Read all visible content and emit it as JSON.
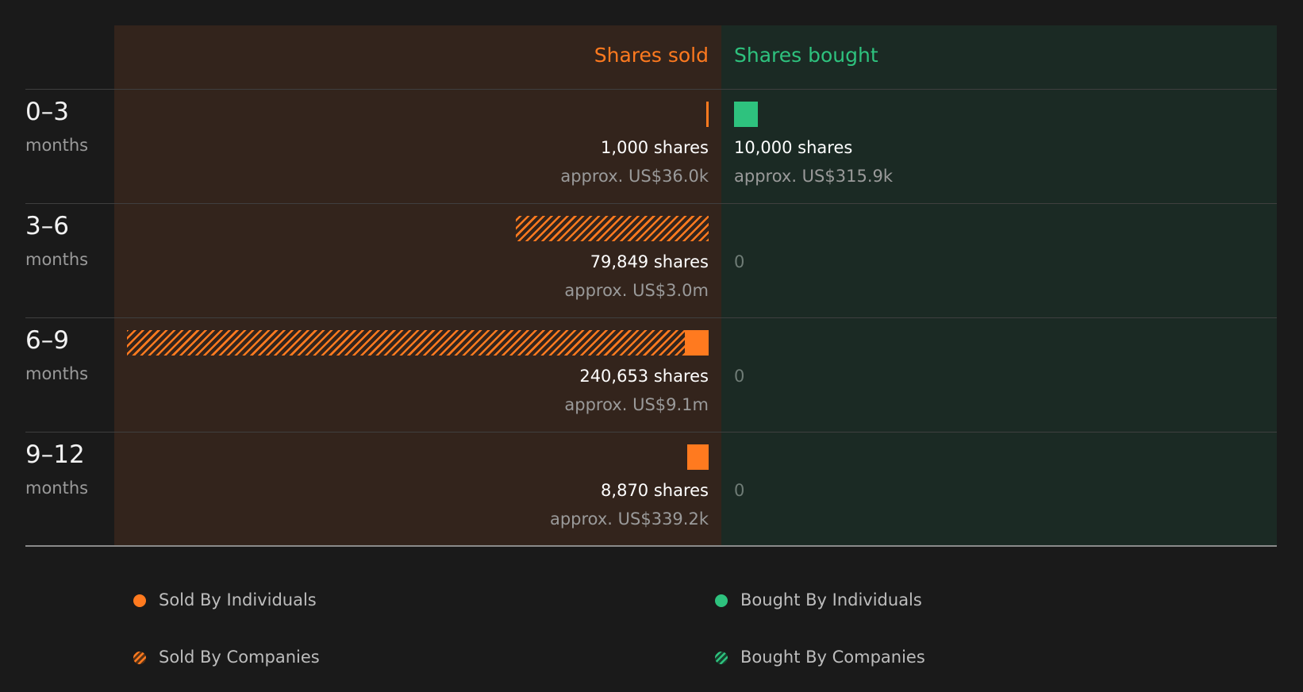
{
  "chart_data": {
    "type": "bar",
    "orientation": "horizontal-diverging",
    "columns": {
      "sold_label": "Shares sold",
      "bought_label": "Shares bought"
    },
    "categories": [
      "0–3",
      "3–6",
      "6–9",
      "9–12"
    ],
    "category_unit": "months",
    "rows": [
      {
        "period": "0–3",
        "unit": "months",
        "sold_individuals": 1000,
        "sold_companies": 0,
        "sold_shares_label": "1,000 shares",
        "sold_value_label": "approx. US$36.0k",
        "bought_individuals": 10000,
        "bought_companies": 0,
        "bought_shares_label": "10,000 shares",
        "bought_value_label": "approx. US$315.9k"
      },
      {
        "period": "3–6",
        "unit": "months",
        "sold_individuals": 0,
        "sold_companies": 79849,
        "sold_shares_label": "79,849 shares",
        "sold_value_label": "approx. US$3.0m",
        "bought_individuals": 0,
        "bought_companies": 0,
        "bought_shares_label": "0",
        "bought_value_label": ""
      },
      {
        "period": "6–9",
        "unit": "months",
        "sold_individuals": 10000,
        "sold_companies": 230653,
        "sold_shares_label": "240,653 shares",
        "sold_value_label": "approx. US$9.1m",
        "bought_individuals": 0,
        "bought_companies": 0,
        "bought_shares_label": "0",
        "bought_value_label": ""
      },
      {
        "period": "9–12",
        "unit": "months",
        "sold_individuals": 8870,
        "sold_companies": 0,
        "sold_shares_label": "8,870 shares",
        "sold_value_label": "approx. US$339.2k",
        "bought_individuals": 0,
        "bought_companies": 0,
        "bought_shares_label": "0",
        "bought_value_label": ""
      }
    ],
    "sold_max": 240653,
    "bought_max": 240653,
    "colors": {
      "sold": "#ff7a1f",
      "bought": "#2ec27e"
    },
    "legend": {
      "placement": "bottom",
      "items": [
        {
          "label": "Sold By Individuals",
          "style": "solid",
          "color": "#ff7a1f"
        },
        {
          "label": "Bought By Individuals",
          "style": "solid",
          "color": "#2ec27e"
        },
        {
          "label": "Sold By Companies",
          "style": "hatched",
          "color": "#ff7a1f"
        },
        {
          "label": "Bought By Companies",
          "style": "hatched",
          "color": "#2ec27e"
        }
      ]
    }
  }
}
